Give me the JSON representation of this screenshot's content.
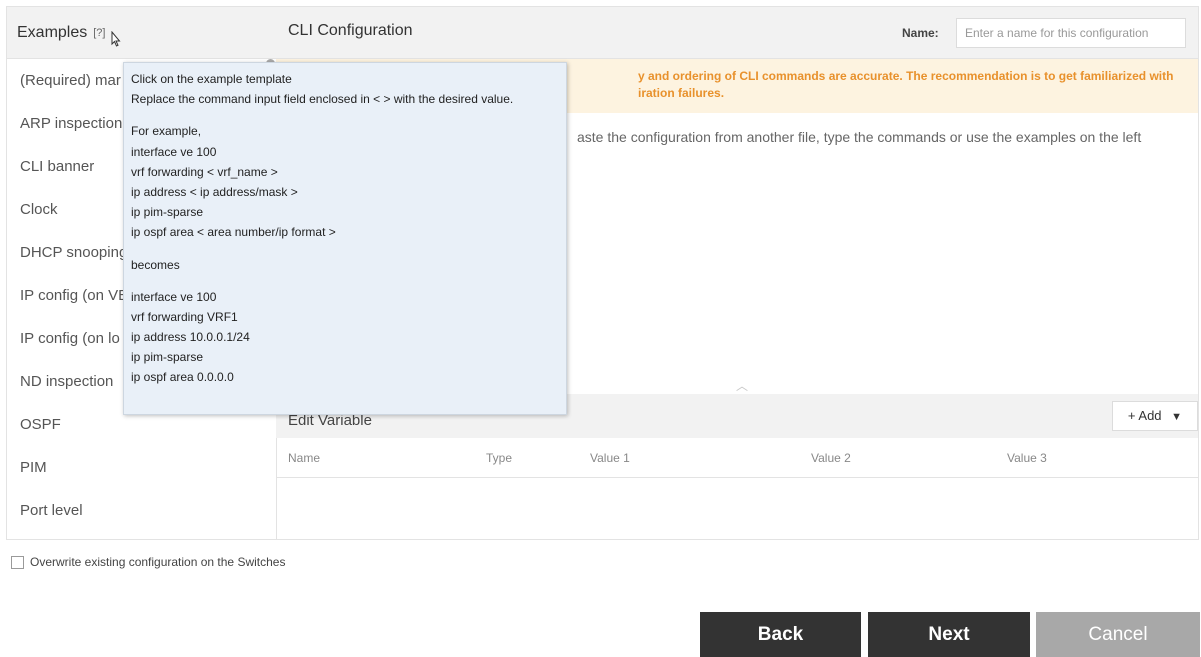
{
  "examples": {
    "title": "Examples",
    "help_mark": "[?]",
    "items": [
      "(Required) mar",
      "ARP inspection",
      "CLI banner",
      "Clock",
      "DHCP snooping",
      "IP config (on VE",
      "IP config (on lo",
      "ND inspection",
      "OSPF",
      "PIM",
      "Port level"
    ]
  },
  "cli": {
    "title": "CLI Configuration",
    "name_label": "Name:",
    "name_placeholder": "Enter a name for this configuration",
    "warning_line1": "y and ordering of CLI commands are accurate. The recommendation is to get familiarized with",
    "warning_line2": "iration failures.",
    "hint": "aste the configuration from another file, type the commands or use the examples on the left"
  },
  "edit_variable": {
    "title": "Edit Variable",
    "add_label": "+ Add",
    "columns": [
      "Name",
      "Type",
      "Value 1",
      "Value 2",
      "Value 3"
    ]
  },
  "tooltip": {
    "lines_a": [
      "Click on the example template",
      "Replace the command input field enclosed in < > with the desired value."
    ],
    "lines_b": [
      "For example,",
      "interface ve 100",
      "vrf forwarding < vrf_name >",
      "ip address < ip address/mask >",
      "ip pim-sparse",
      "ip ospf area < area number/ip format >"
    ],
    "lines_c": [
      "becomes"
    ],
    "lines_d": [
      "interface ve 100",
      "vrf forwarding VRF1",
      "ip address 10.0.0.1/24",
      "ip pim-sparse",
      "ip ospf area 0.0.0.0"
    ]
  },
  "footer": {
    "overwrite_label": "Overwrite existing configuration on the Switches",
    "back": "Back",
    "next": "Next",
    "cancel": "Cancel"
  }
}
